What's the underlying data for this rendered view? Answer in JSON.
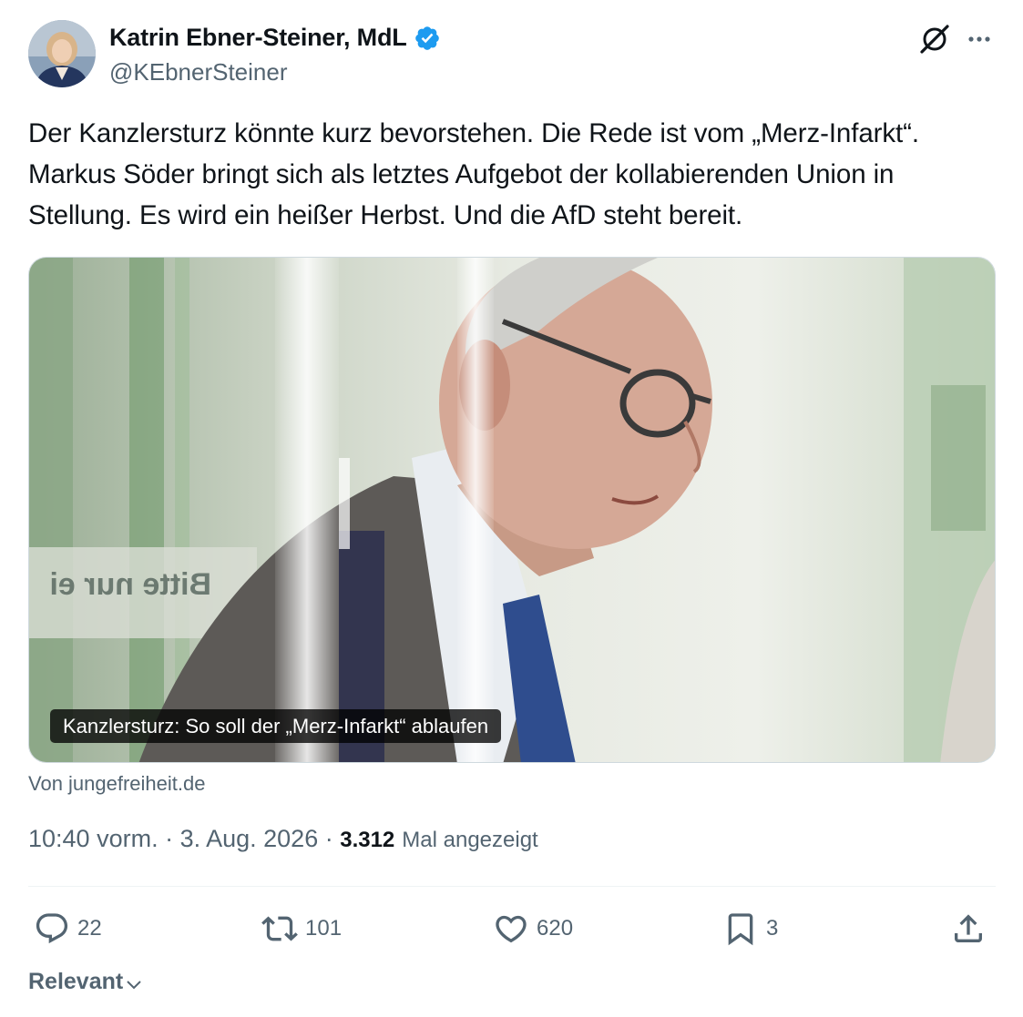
{
  "author": {
    "name": "Katrin Ebner-Steiner, MdL",
    "handle": "@KEbnerSteiner",
    "verified_color": "#1d9bf0"
  },
  "tweet": {
    "text": "Der Kanzlersturz könnte kurz bevorstehen. Die Rede ist vom „Merz-Infarkt“. Markus Söder bringt sich als letztes Aufgebot der kollabierenden Union in Stellung. Es wird ein heißer Herbst. Und die AfD steht bereit."
  },
  "card": {
    "caption": "Kanzlersturz: So soll der „Merz-Infarkt“ ablaufen",
    "source": "Von jungefreiheit.de",
    "image_sign_text": "Bitte nur ei"
  },
  "meta": {
    "time": "10:40 vorm.",
    "separator1": " · ",
    "date": "3. Aug. 2026",
    "separator2": " · ",
    "views": "3.312",
    "views_label": "Mal angezeigt"
  },
  "actions": {
    "replies": "22",
    "reposts": "101",
    "likes": "620",
    "bookmarks": "3"
  },
  "icons": {
    "grok": "grok-icon",
    "more": "more-dots-icon",
    "reply": "reply-icon",
    "repost": "repost-icon",
    "like": "heart-icon",
    "bookmark": "bookmark-icon",
    "share": "share-icon",
    "chevron": "chevron-down-icon"
  },
  "replies_sort": {
    "label": "Relevant"
  },
  "colors": {
    "text_primary": "#0f1419",
    "text_secondary": "#536471",
    "border": "#cfd9de",
    "accent": "#1d9bf0"
  }
}
